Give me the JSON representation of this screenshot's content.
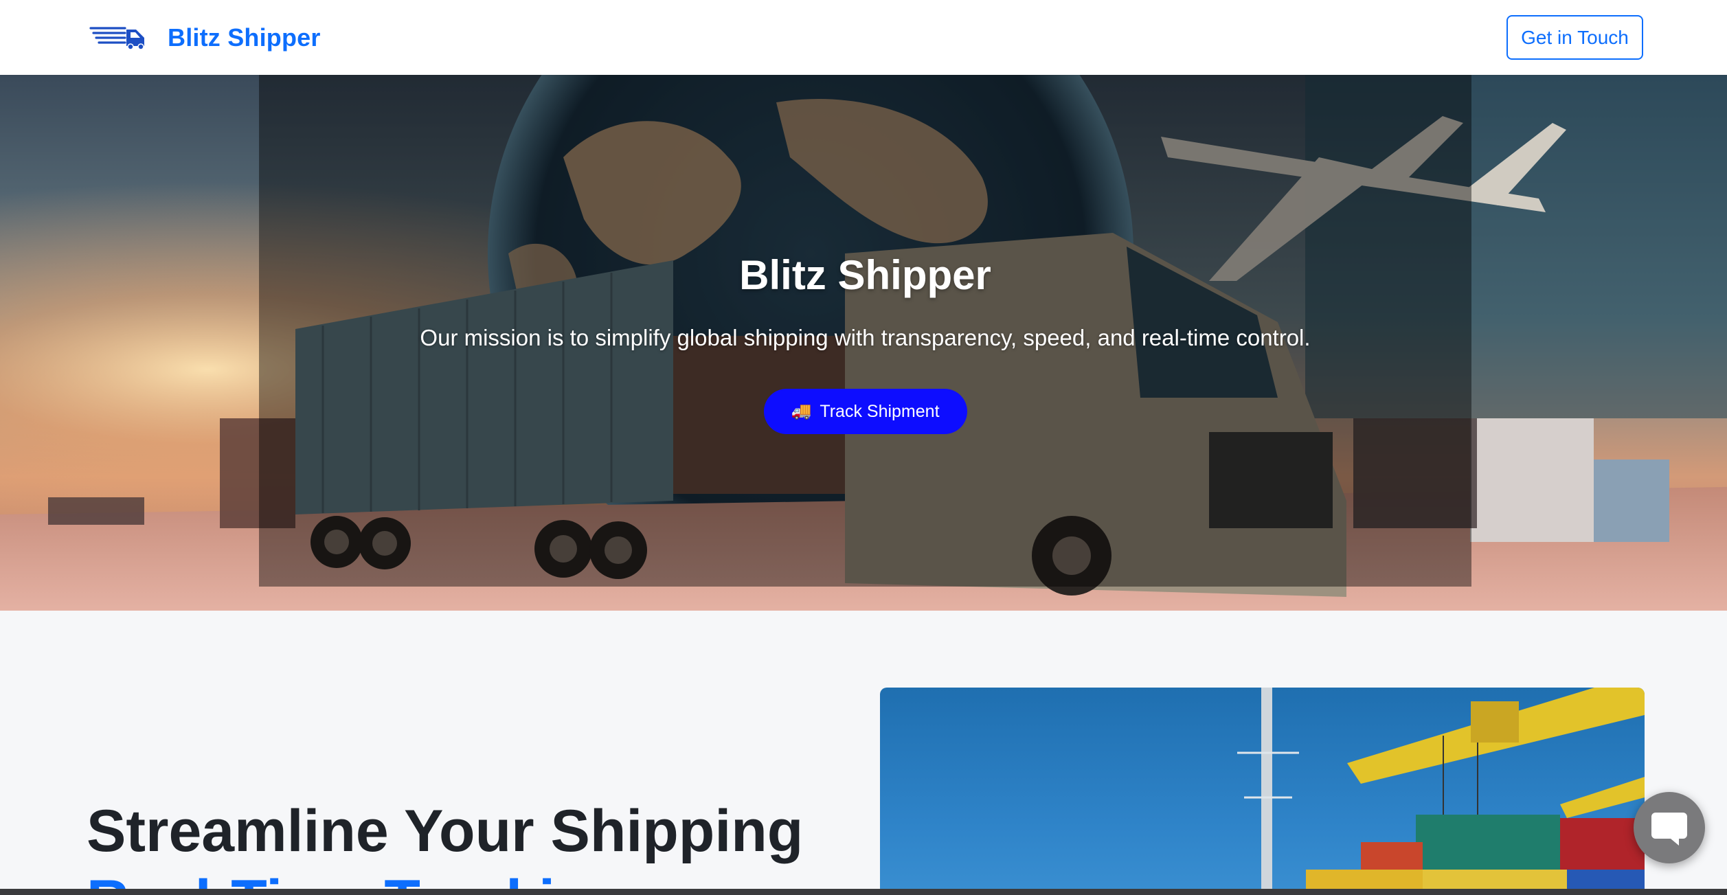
{
  "brand": {
    "name": "Blitz Shipper",
    "logo_icon": "speeding-truck-icon",
    "color": "#0d6efd"
  },
  "nav": {
    "cta_label": "Get in Touch"
  },
  "hero": {
    "title": "Blitz Shipper",
    "subtitle": "Our mission is to simplify global shipping with transparency, speed, and real-time control.",
    "button_icon": "🚚",
    "button_label": "Track Shipment",
    "button_color": "#0d0dff",
    "background_image": "truck-globe-airplane-photo"
  },
  "feature": {
    "heading_line1": "Streamline Your Shipping",
    "heading_line2": "Real-Time Tracking",
    "image": "port-cranes-containers-photo"
  },
  "chat": {
    "icon": "chat-bubble-icon"
  }
}
